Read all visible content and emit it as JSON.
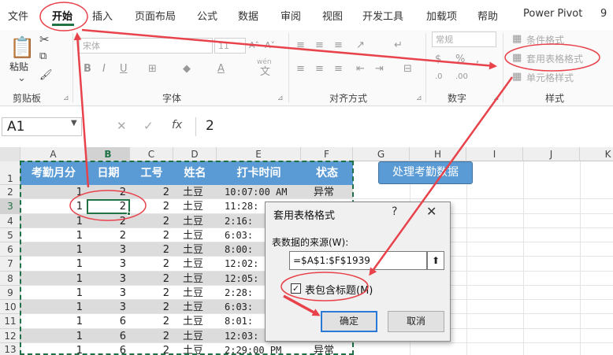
{
  "menu": {
    "tabs": [
      "文件",
      "开始",
      "插入",
      "页面布局",
      "公式",
      "数据",
      "审阅",
      "视图",
      "开发工具",
      "加载项",
      "帮助",
      "Power Pivot",
      "9"
    ]
  },
  "ribbon": {
    "paste": "粘贴",
    "font_name": "宋体",
    "font_size": "11",
    "wen": "wén",
    "number_format": "常规",
    "cond_format": "条件格式",
    "table_format": "套用表格格式",
    "cell_style": "单元格样式",
    "groups": [
      "剪贴板",
      "字体",
      "对齐方式",
      "数字",
      "样式"
    ]
  },
  "formula": {
    "name_box": "A1",
    "content": "2"
  },
  "columns": [
    "A",
    "B",
    "C",
    "D",
    "E",
    "F",
    "G",
    "H",
    "I",
    "J",
    "K"
  ],
  "rows": [
    "1",
    "2",
    "3",
    "4",
    "5",
    "6",
    "7",
    "8",
    "9",
    "10",
    "11",
    "12",
    "13"
  ],
  "headers": [
    "考勤月分",
    "日期",
    "工号",
    "姓名",
    "打卡时间",
    "状态"
  ],
  "data": [
    [
      "1",
      "2",
      "2",
      "土豆",
      "10:07:00 AM",
      "异常"
    ],
    [
      "1",
      "2",
      "2",
      "土豆",
      "11:28:",
      ""
    ],
    [
      "1",
      "2",
      "2",
      "土豆",
      "2:16:",
      ""
    ],
    [
      "1",
      "2",
      "2",
      "土豆",
      "6:03:",
      ""
    ],
    [
      "1",
      "3",
      "2",
      "土豆",
      "8:00:",
      ""
    ],
    [
      "1",
      "3",
      "2",
      "土豆",
      "12:02:",
      ""
    ],
    [
      "1",
      "3",
      "2",
      "土豆",
      "12:05:",
      ""
    ],
    [
      "1",
      "3",
      "2",
      "土豆",
      "2:28:",
      ""
    ],
    [
      "1",
      "3",
      "2",
      "土豆",
      "6:03:",
      ""
    ],
    [
      "1",
      "6",
      "2",
      "土豆",
      "8:01:",
      ""
    ],
    [
      "1",
      "6",
      "2",
      "土豆",
      "12:03:",
      ""
    ],
    [
      "1",
      "6",
      "2",
      "土豆",
      "2:29:00 PM",
      "异常"
    ]
  ],
  "button": "处理考勤数据",
  "dialog": {
    "title": "套用表格格式",
    "help": "?",
    "close": "✕",
    "source_label": "表数据的来源(W):",
    "source_value": "=$A$1:$F$1939",
    "header_checkbox": "表包含标题(M)",
    "ok": "确定",
    "cancel": "取消"
  },
  "colors": {
    "accent": "#217346",
    "header_fill": "#5b9bd5",
    "annotation": "#e8424b"
  }
}
